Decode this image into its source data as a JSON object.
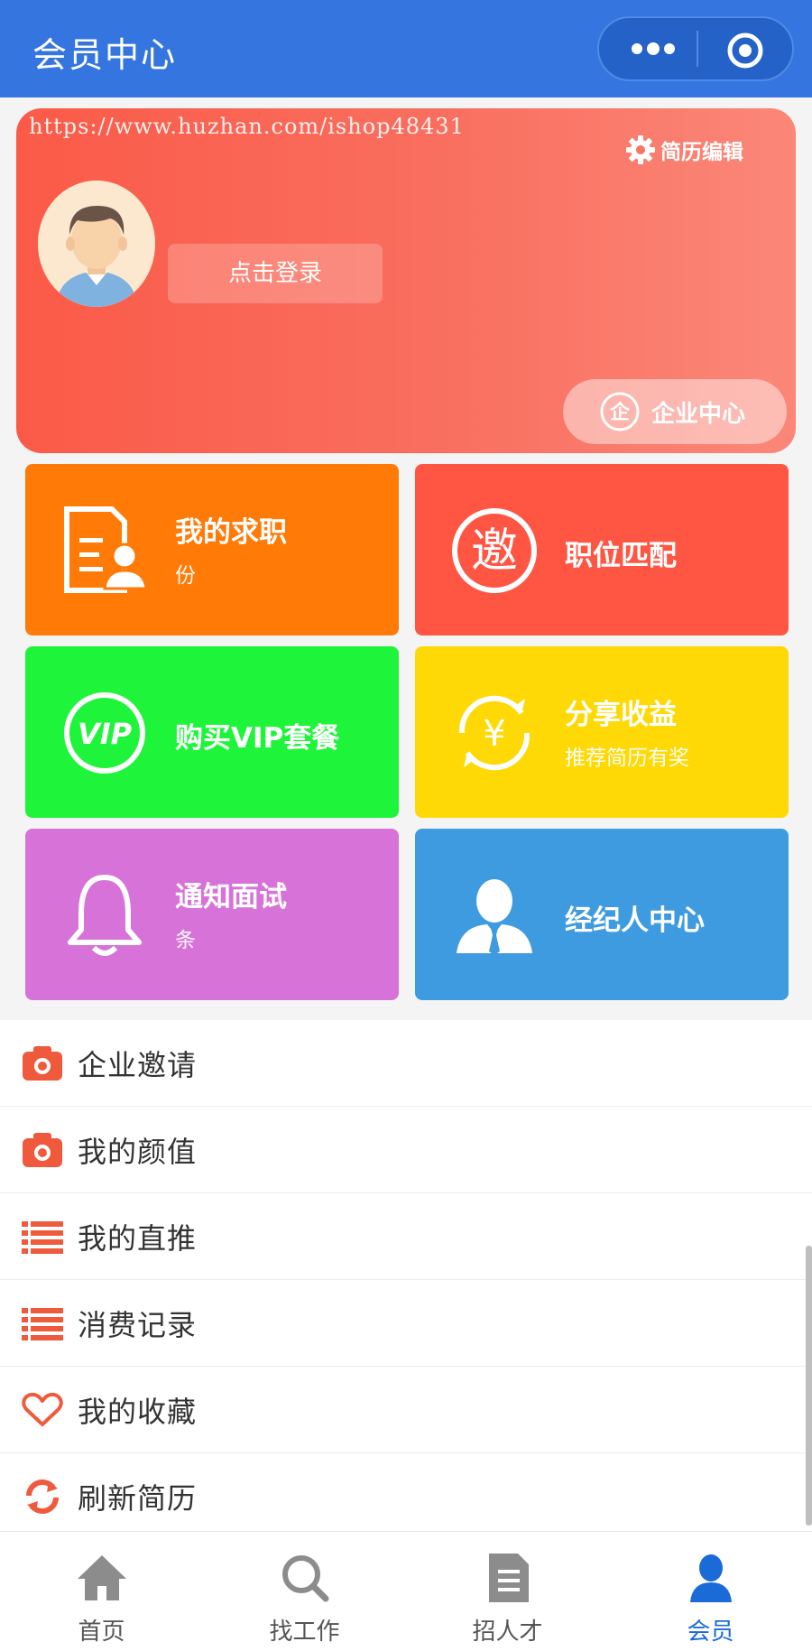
{
  "header": {
    "title": "会员中心"
  },
  "profile": {
    "watermark": "https://www.huzhan.com/ishop48431",
    "resume_edit": "简历编辑",
    "login": "点击登录",
    "company_center": "企业中心"
  },
  "tiles": [
    {
      "title": "我的求职",
      "sub": "份",
      "color": "#ff7a06",
      "icon": "resume-icon"
    },
    {
      "title": "职位匹配",
      "sub": "",
      "color": "#ff5543",
      "icon": "invite-icon"
    },
    {
      "title": "购买VIP套餐",
      "sub": "",
      "color": "#1ef53a",
      "icon": "vip-icon"
    },
    {
      "title": "分享收益",
      "sub": "推荐简历有奖",
      "color": "#ffd905",
      "icon": "yuan-icon"
    },
    {
      "title": "通知面试",
      "sub": "条",
      "color": "#d773d8",
      "icon": "bell-icon"
    },
    {
      "title": "经纪人中心",
      "sub": "",
      "color": "#3f9be0",
      "icon": "agent-icon"
    }
  ],
  "menu": [
    {
      "label": "企业邀请",
      "icon": "camera-icon"
    },
    {
      "label": "我的颜值",
      "icon": "camera-icon"
    },
    {
      "label": "我的直推",
      "icon": "list-icon"
    },
    {
      "label": "消费记录",
      "icon": "list-icon"
    },
    {
      "label": "我的收藏",
      "icon": "heart-icon"
    },
    {
      "label": "刷新简历",
      "icon": "refresh-icon"
    }
  ],
  "tabbar": [
    {
      "label": "首页",
      "icon": "home-icon"
    },
    {
      "label": "找工作",
      "icon": "search-icon"
    },
    {
      "label": "招人才",
      "icon": "document-icon"
    },
    {
      "label": "会员",
      "icon": "member-icon",
      "active": true
    }
  ],
  "colors": {
    "header": "#3575e0",
    "accent_red": "#f05a3c",
    "tab_active": "#1a6bd8"
  }
}
